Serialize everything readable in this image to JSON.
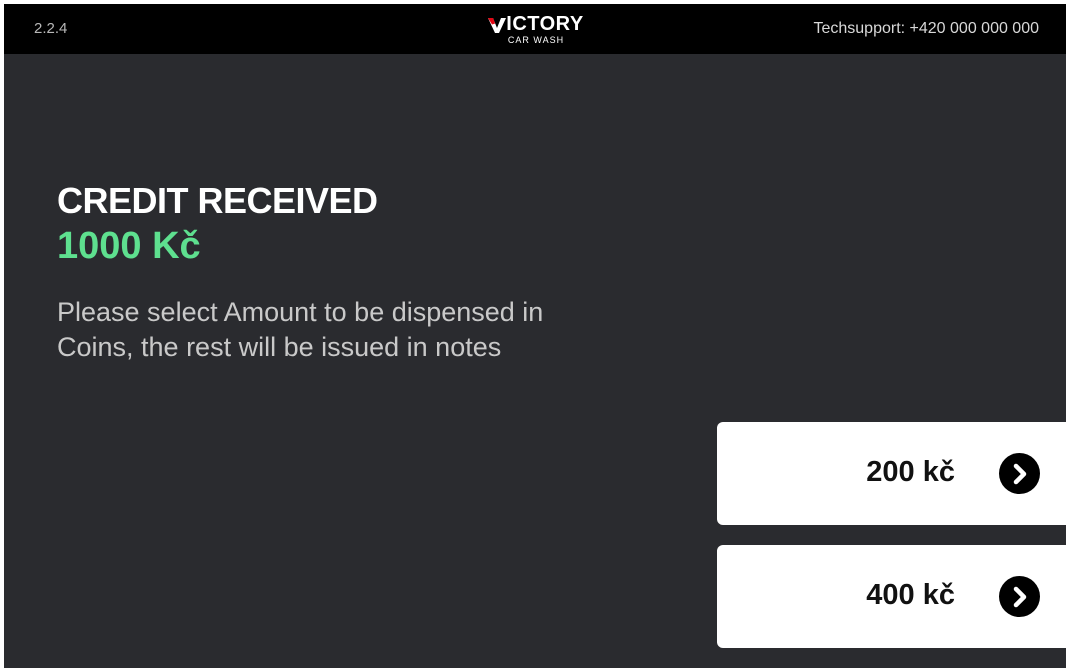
{
  "header": {
    "version": "2.2.4",
    "logo": {
      "brand": "VICTORY",
      "brand_rest": "ICTORY",
      "subtitle": "CAR WASH",
      "accent_color": "#e30613"
    },
    "techsupport": "Techsupport: +420 000 000 000"
  },
  "main": {
    "title": "CREDIT RECEIVED",
    "credit_amount": "1000 Kč",
    "instruction_line1": "Please select Amount to be dispensed in",
    "instruction_line2": "Coins, the rest will be issued in notes"
  },
  "options": [
    {
      "label": "200 kč",
      "icon": "chevron-right-circle-icon"
    },
    {
      "label": "400 kč",
      "icon": "chevron-right-circle-icon"
    }
  ],
  "colors": {
    "background": "#2a2b2f",
    "header_background": "#000000",
    "credit_green": "#5ee08f",
    "button_background": "#ffffff"
  }
}
